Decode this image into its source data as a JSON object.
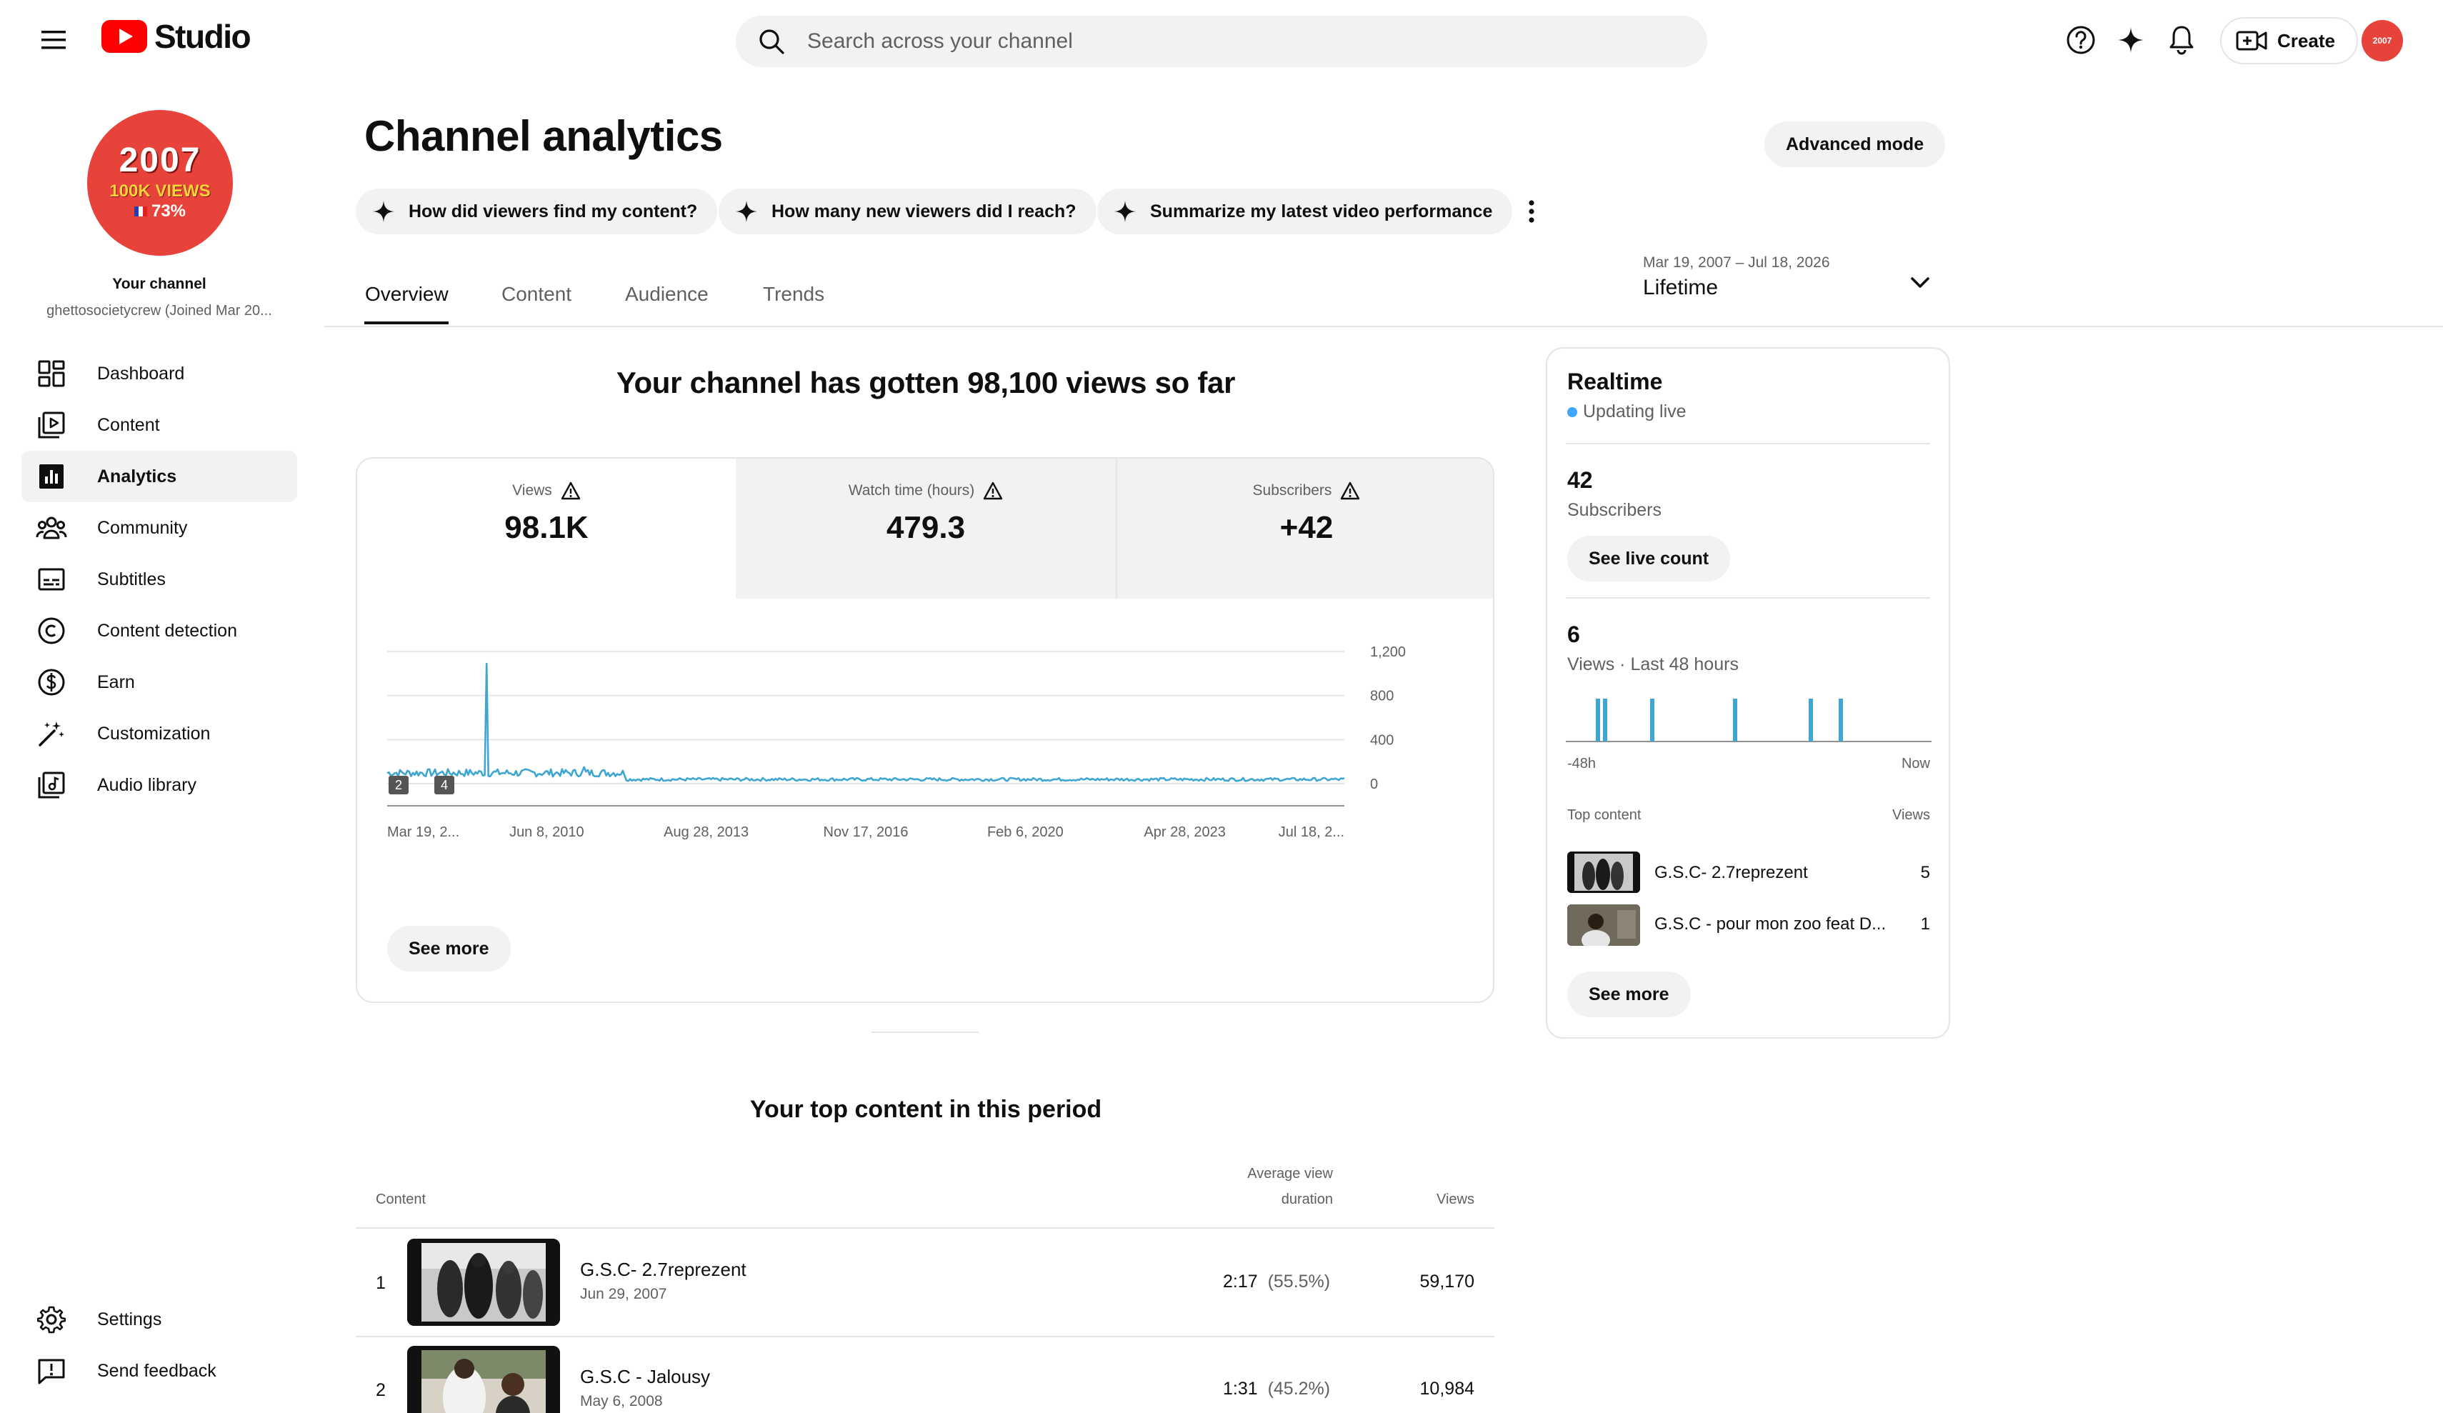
{
  "app": {
    "name": "Studio"
  },
  "search": {
    "placeholder": "Search across your channel"
  },
  "header": {
    "create_label": "Create",
    "avatar_text": "2007"
  },
  "channel": {
    "avatar": {
      "year": "2007",
      "views_badge": "100K VIEWS",
      "percent": "73%"
    },
    "title": "Your channel",
    "handle": "ghettosocietycrew (Joined Mar 20..."
  },
  "sidebar": {
    "items": [
      {
        "label": "Dashboard",
        "icon": "dashboard-icon"
      },
      {
        "label": "Content",
        "icon": "content-icon"
      },
      {
        "label": "Analytics",
        "icon": "analytics-icon",
        "active": true
      },
      {
        "label": "Community",
        "icon": "community-icon"
      },
      {
        "label": "Subtitles",
        "icon": "subtitles-icon"
      },
      {
        "label": "Content detection",
        "icon": "copyright-icon"
      },
      {
        "label": "Earn",
        "icon": "dollar-icon"
      },
      {
        "label": "Customization",
        "icon": "magic-wand-icon"
      },
      {
        "label": "Audio library",
        "icon": "audio-library-icon"
      }
    ],
    "footer": [
      {
        "label": "Settings",
        "icon": "gear-icon"
      },
      {
        "label": "Send feedback",
        "icon": "feedback-icon"
      }
    ]
  },
  "page": {
    "title": "Channel analytics",
    "advanced_mode": "Advanced mode",
    "chips": [
      "How did viewers find my content?",
      "How many new viewers did I reach?",
      "Summarize my latest video performance"
    ],
    "tabs": [
      "Overview",
      "Content",
      "Audience",
      "Trends"
    ],
    "date_range": "Mar 19, 2007 – Jul 18, 2026",
    "date_label": "Lifetime"
  },
  "overview": {
    "headline": "Your channel has gotten 98,100 views so far",
    "metrics": [
      {
        "label": "Views",
        "value": "98.1K"
      },
      {
        "label": "Watch time (hours)",
        "value": "479.3"
      },
      {
        "label": "Subscribers",
        "value": "+42"
      }
    ],
    "see_more": "See more",
    "markers": [
      "2",
      "4"
    ]
  },
  "chart_data": {
    "type": "line",
    "series": [
      {
        "name": "Views"
      }
    ],
    "x_ticks": [
      "Mar 19, 2...",
      "Jun 8, 2010",
      "Aug 28, 2013",
      "Nov 17, 2016",
      "Feb 6, 2020",
      "Apr 28, 2023",
      "Jul 18, 2..."
    ],
    "y_ticks": [
      "1,200",
      "800",
      "400",
      "0"
    ],
    "ylim": [
      0,
      1200
    ],
    "grid": true,
    "baseline_value": 45,
    "spikes": [
      {
        "x_fraction": 0.104,
        "value": 1090
      },
      {
        "x_fraction": 0.205,
        "value": 150
      }
    ]
  },
  "top_content": {
    "title": "Your top content in this period",
    "col_content": "Content",
    "col_avd_1": "Average view",
    "col_avd_2": "duration",
    "col_views": "Views",
    "rows": [
      {
        "rank": "1",
        "title": "G.S.C- 2.7reprezent",
        "date": "Jun 29, 2007",
        "avd": "2:17",
        "avd_pct": "(55.5%)",
        "views": "59,170"
      },
      {
        "rank": "2",
        "title": "G.S.C - Jalousy",
        "date": "May 6, 2008",
        "avd": "1:31",
        "avd_pct": "(45.2%)",
        "views": "10,984"
      }
    ]
  },
  "realtime": {
    "title": "Realtime",
    "status": "Updating live",
    "subs_value": "42",
    "subs_label": "Subscribers",
    "live_count_btn": "See live count",
    "views_value": "6",
    "views_label": "Views · Last 48 hours",
    "axis_start": "-48h",
    "axis_end": "Now",
    "top_content_label": "Top content",
    "views_col": "Views",
    "items": [
      {
        "title": "G.S.C- 2.7reprezent",
        "views": "5"
      },
      {
        "title": "G.S.C - pour mon zoo feat D...",
        "views": "1"
      }
    ],
    "see_more": "See more"
  },
  "colors": {
    "accent": "#3ea6d0",
    "brand_red": "#ff0000",
    "live_dot": "#3ea6ff"
  }
}
